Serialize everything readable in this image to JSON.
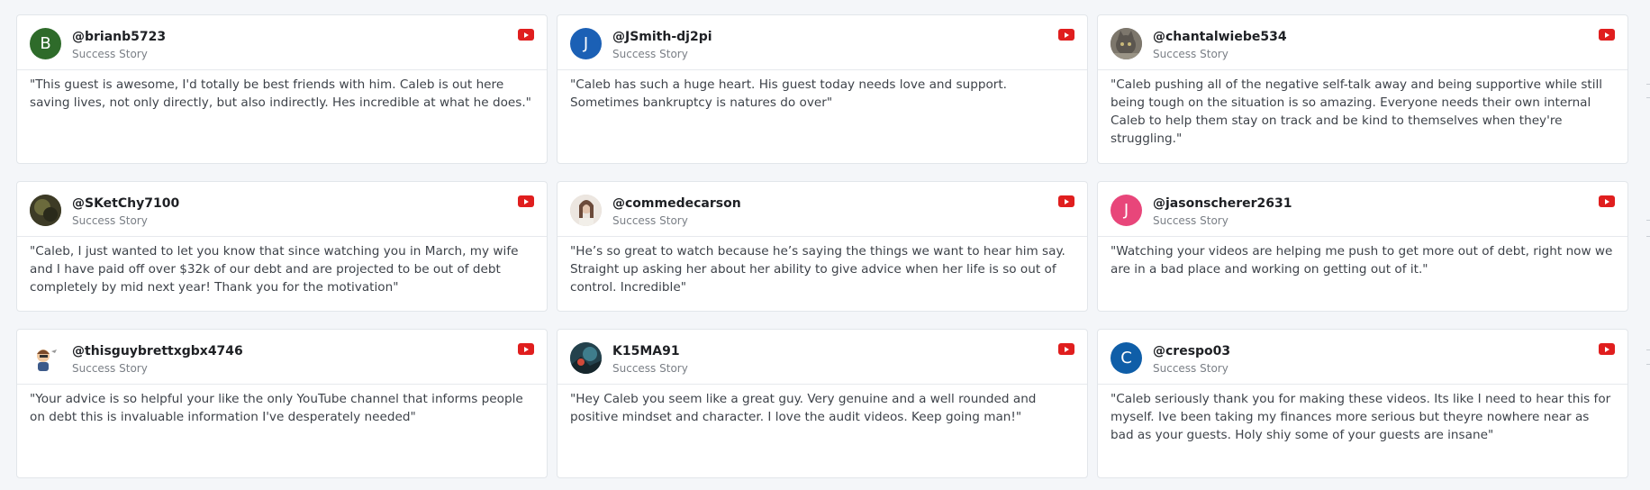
{
  "cards": [
    {
      "username": "@brianb5723",
      "subtitle": "Success Story",
      "avatar": {
        "type": "letter",
        "letter": "B",
        "color": "#2e6b2a"
      },
      "text": "\"This guest is awesome, I'd totally be best friends with him. Caleb is out here saving lives, not only directly, but also indirectly. Hes incredible at what he does.\""
    },
    {
      "username": "@JSmith-dj2pi",
      "subtitle": "Success Story",
      "avatar": {
        "type": "letter",
        "letter": "J",
        "color": "#1b60b5"
      },
      "text": "\"Caleb has such a huge heart. His guest today needs love and support. Sometimes bankruptcy is natures do over\""
    },
    {
      "username": "@chantalwiebe534",
      "subtitle": "Success Story",
      "avatar": {
        "type": "photo",
        "name": "cat-photo",
        "color": "#6f6a62"
      },
      "text": "\"Caleb pushing all of the negative self-talk away and being supportive while still being tough on the situation is so amazing. Everyone needs their own internal Caleb to help them stay on track and be kind to themselves when they're struggling.\""
    },
    {
      "username": "@SKetChy7100",
      "subtitle": "Success Story",
      "avatar": {
        "type": "photo",
        "name": "dark-photo",
        "color": "#4a4a2f"
      },
      "text": "\"Caleb, I just wanted to let you know that since watching you in March, my wife and I have paid off over $32k of our debt and are projected to be out of debt completely by mid next year! Thank you for the motivation\""
    },
    {
      "username": "@commedecarson",
      "subtitle": "Success Story",
      "avatar": {
        "type": "photo",
        "name": "person-photo",
        "color": "#d9cfc6"
      },
      "text": "\"He’s so great to watch because he’s saying the things we want to hear him say. Straight up asking her about her ability to give advice when her life is so out of control. Incredible\""
    },
    {
      "username": "@jasonscherer2631",
      "subtitle": "Success Story",
      "avatar": {
        "type": "letter",
        "letter": "J",
        "color": "#e8467a"
      },
      "text": "\"Watching your videos are helping me push to get more out of debt, right now we are in a bad place and working on getting out of it.\""
    },
    {
      "username": "@thisguybrettxgbx4746",
      "subtitle": "Success Story",
      "avatar": {
        "type": "photo",
        "name": "cartoon-avatar",
        "color": "#ffffff"
      },
      "text": "\"Your advice is so helpful your like the only YouTube channel that informs people on debt this is invaluable information I've desperately needed\""
    },
    {
      "username": "K15MA91",
      "subtitle": "Success Story",
      "avatar": {
        "type": "photo",
        "name": "landscape-photo",
        "color": "#2f4f5a"
      },
      "text": "\"Hey Caleb you seem like a great guy. Very genuine and a well rounded and positive mindset and character. I love the audit videos. Keep going man!\""
    },
    {
      "username": "@crespo03",
      "subtitle": "Success Story",
      "avatar": {
        "type": "letter",
        "letter": "C",
        "color": "#0f5ea8"
      },
      "text": "\"Caleb seriously thank you for making these videos. Its like I need to hear this for myself. Ive been taking my finances more serious but theyre nowhere near as bad as your guests. Holy shiy some of your guests are insane\""
    }
  ],
  "icons": {
    "platform": "youtube-icon",
    "platform_color": "#e01e1e"
  }
}
